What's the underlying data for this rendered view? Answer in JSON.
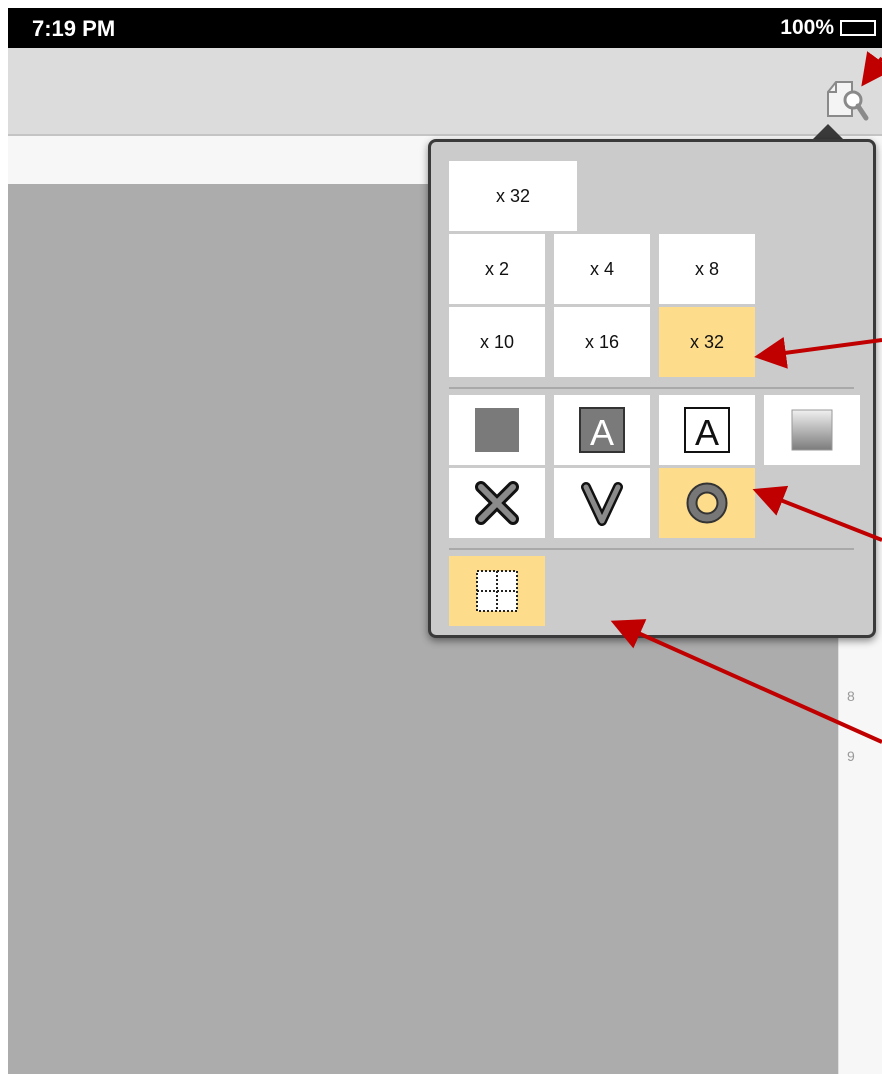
{
  "status_bar": {
    "time": "7:19 PM",
    "battery": "100%"
  },
  "toolbar": {
    "icon": "inspect-page-icon"
  },
  "popover": {
    "current_value": "x 32",
    "zoom_options": [
      "x 2",
      "x 4",
      "x 8",
      "x 10",
      "x 16",
      "x 32"
    ],
    "selected_zoom": "x 32",
    "style_options": [
      "filled-square",
      "filled-letter-a",
      "outlined-letter-a",
      "gradient-square"
    ],
    "marker_options": [
      "x-mark",
      "v-mark",
      "o-mark"
    ],
    "selected_marker": "o-mark",
    "grid_toggle": "dashed-grid",
    "grid_selected": true
  },
  "line_numbers": [
    "8",
    "9"
  ],
  "colors": {
    "highlight": "#fddc8c",
    "canvas": "#acacac",
    "arrow": "#c00000"
  }
}
